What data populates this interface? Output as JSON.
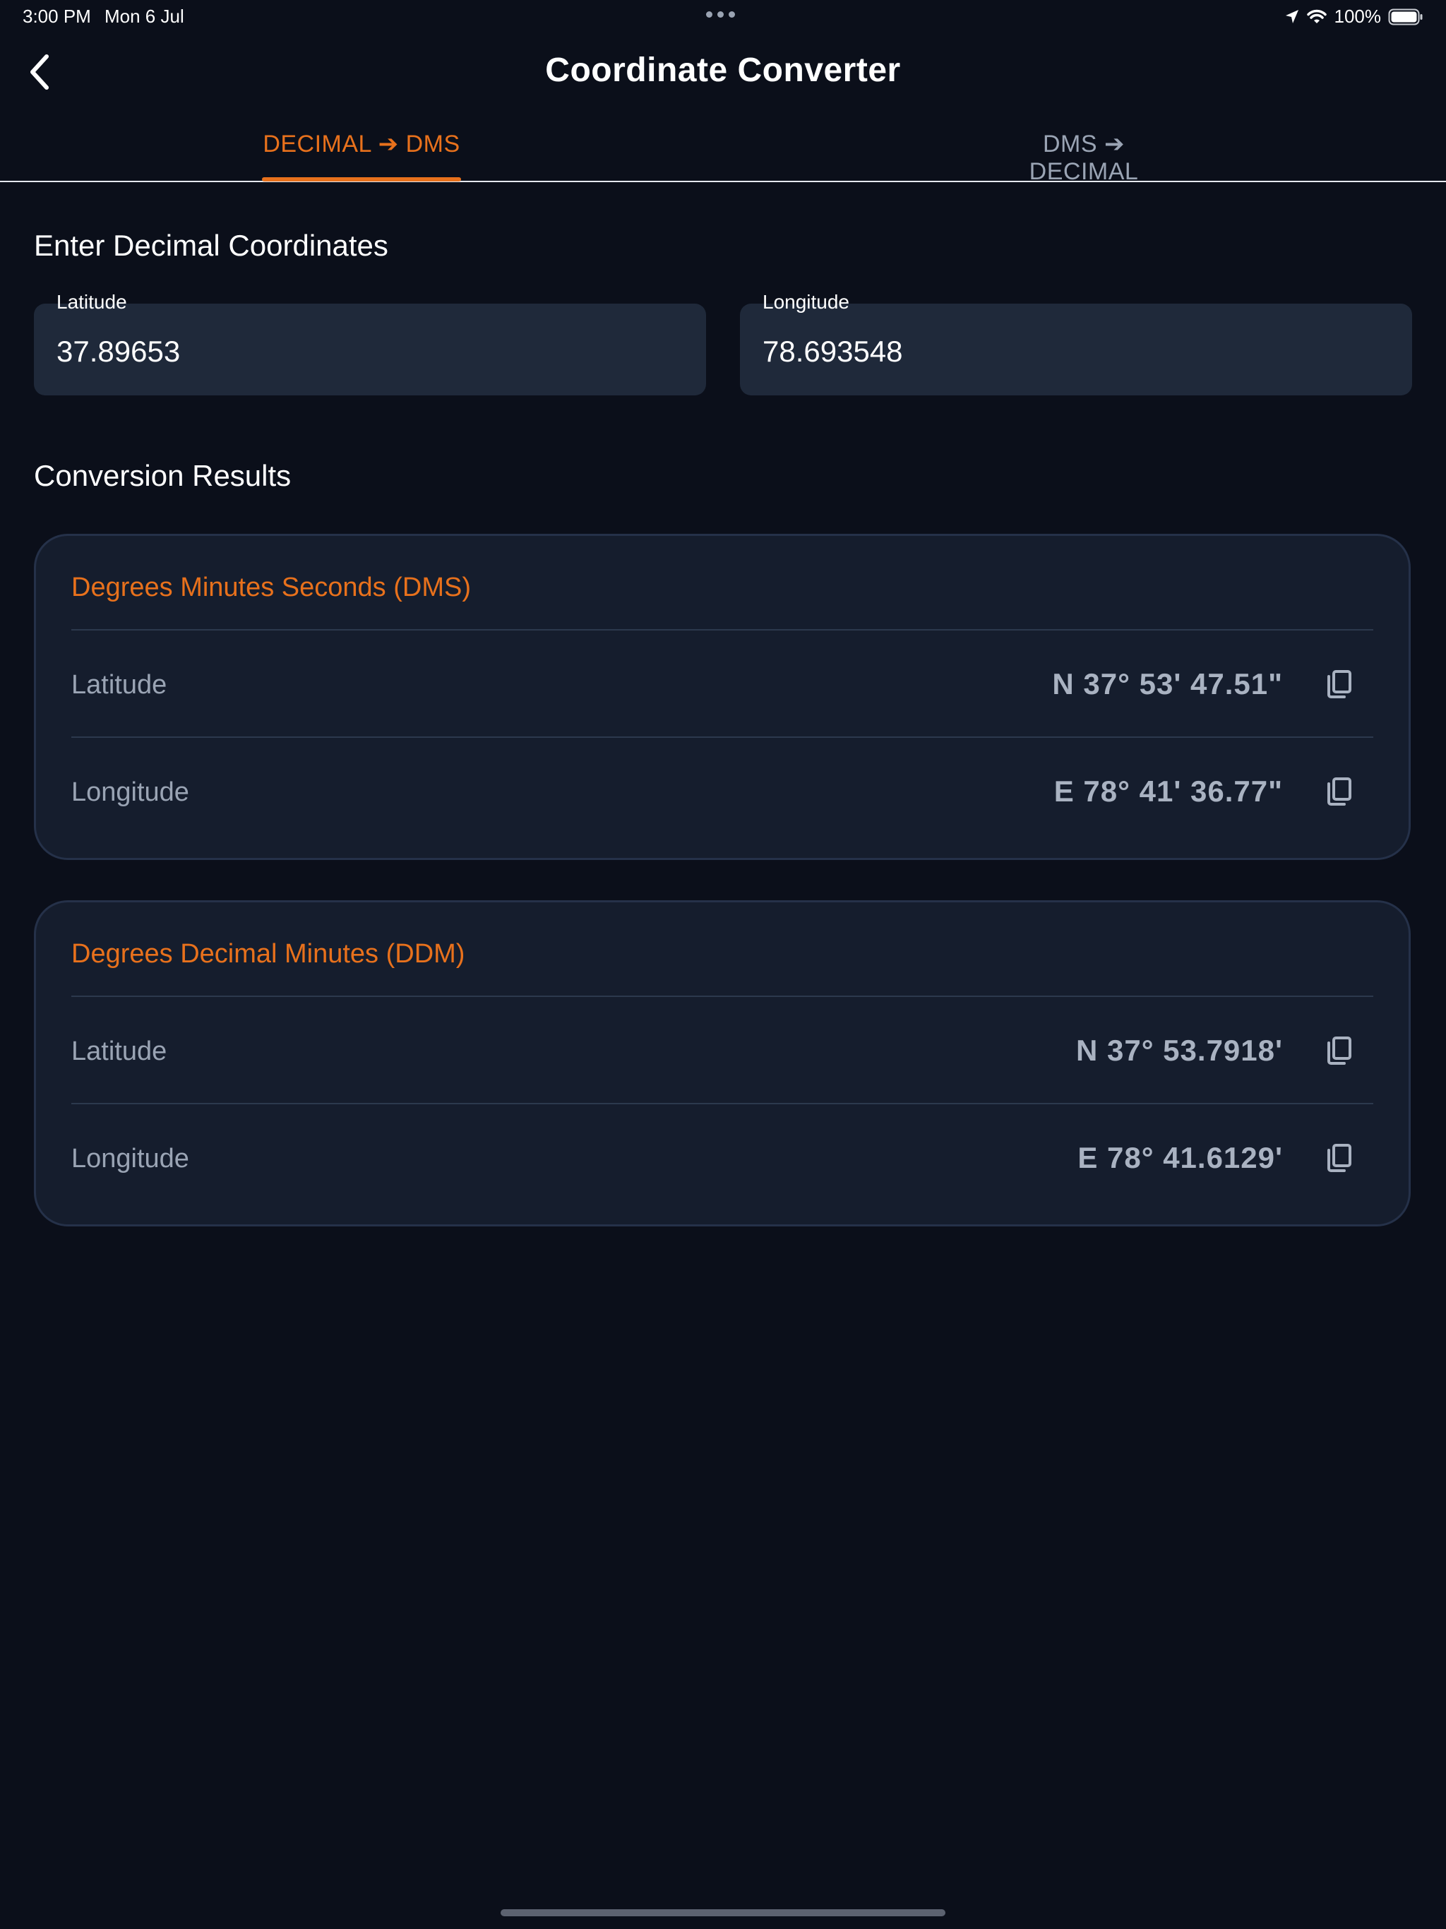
{
  "status_bar": {
    "time": "3:00 PM",
    "date": "Mon 6 Jul",
    "battery": "100%",
    "icons": [
      "location-arrow-icon",
      "wifi-icon",
      "battery-icon"
    ]
  },
  "header": {
    "title": "Coordinate Converter",
    "back_icon": "chevron-left-icon"
  },
  "tabs": [
    {
      "label": "DECIMAL ➔ DMS",
      "active": true
    },
    {
      "label": "DMS ➔ DECIMAL",
      "active": false
    }
  ],
  "input_section": {
    "heading": "Enter Decimal Coordinates",
    "latitude": {
      "label": "Latitude",
      "value": "37.89653"
    },
    "longitude": {
      "label": "Longitude",
      "value": "78.693548"
    }
  },
  "results": {
    "heading": "Conversion Results",
    "cards": [
      {
        "title": "Degrees Minutes Seconds (DMS)",
        "rows": [
          {
            "label": "Latitude",
            "value": "N 37° 53' 47.51\"",
            "icon": "copy-icon"
          },
          {
            "label": "Longitude",
            "value": "E 78° 41' 36.77\"",
            "icon": "copy-icon"
          }
        ]
      },
      {
        "title": "Degrees Decimal Minutes (DDM)",
        "rows": [
          {
            "label": "Latitude",
            "value": "N 37° 53.7918'",
            "icon": "copy-icon"
          },
          {
            "label": "Longitude",
            "value": "E 78° 41.6129'",
            "icon": "copy-icon"
          }
        ]
      }
    ]
  },
  "colors": {
    "background": "#0b0f1a",
    "accent": "#e8711c",
    "card": "#151d2d",
    "input": "#1f293a",
    "muted_text": "#9aa4b4"
  }
}
